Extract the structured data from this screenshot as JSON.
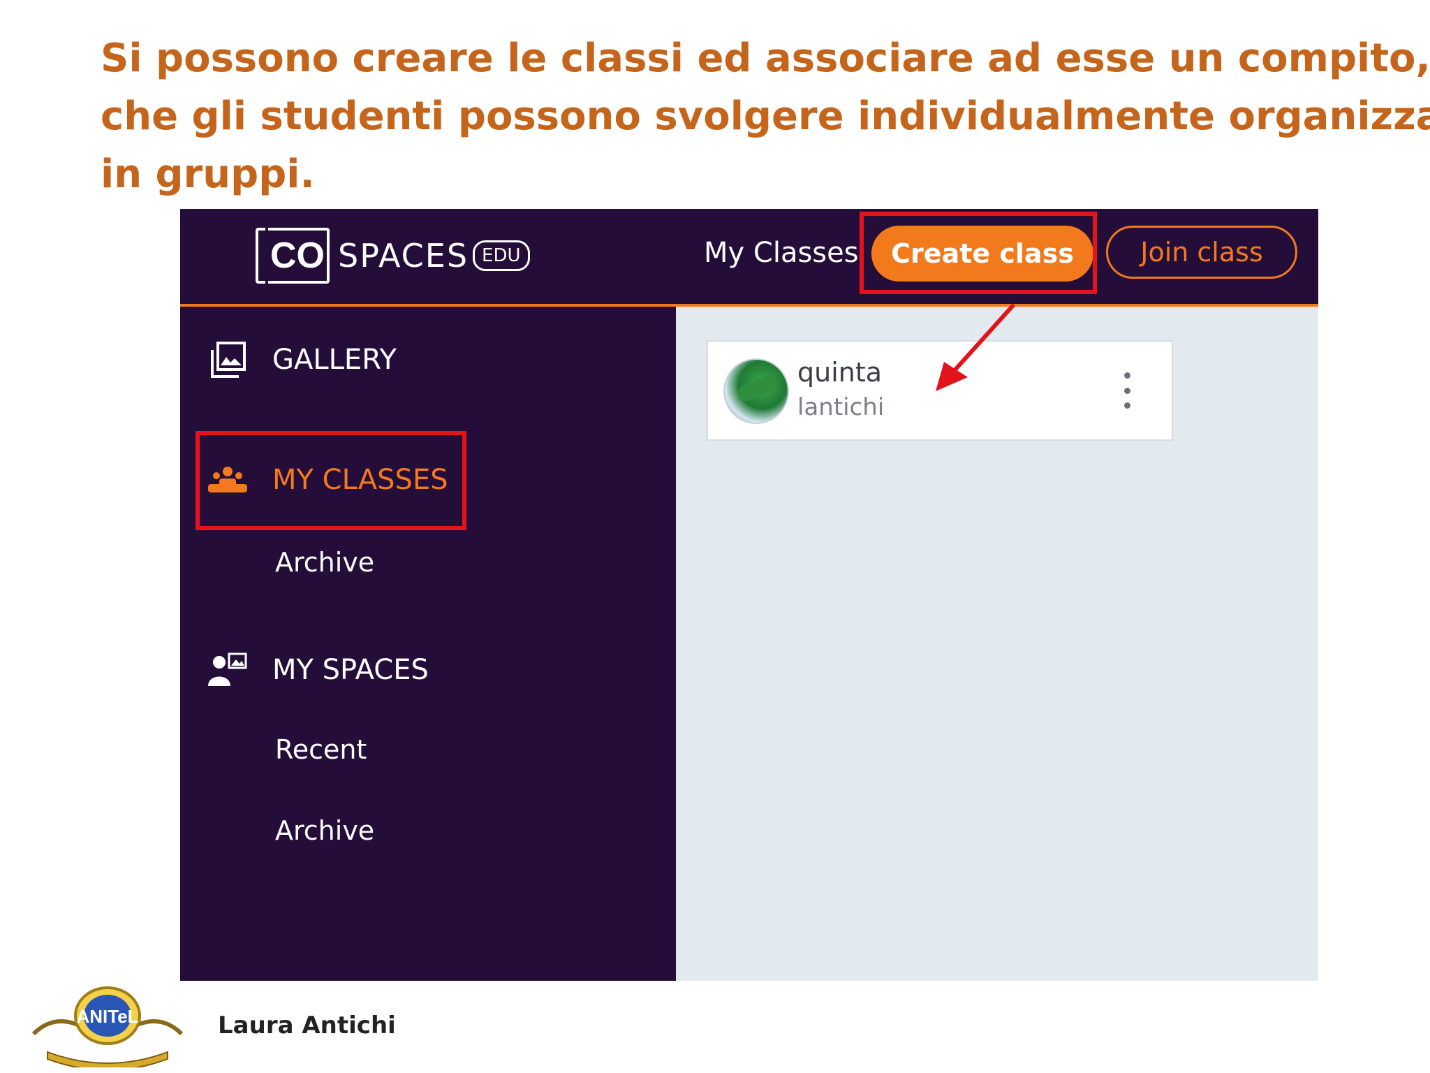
{
  "slide": {
    "title_lines": [
      "Si possono creare le classi ed associare ad esse un compito,",
      "che gli studenti possono svolgere individualmente organizzati",
      "in gruppi."
    ],
    "author": "Laura Antichi",
    "logo_text": "ANITeL"
  },
  "app": {
    "logo": {
      "co": "CO",
      "spaces": "SPACES",
      "edu": "EDU"
    },
    "topbar": {
      "my_classes": "My Classes",
      "create_class": "Create class",
      "join_class": "Join class"
    },
    "sidebar": {
      "gallery": "GALLERY",
      "my_classes": "MY CLASSES",
      "classes_archive": "Archive",
      "my_spaces": "MY SPACES",
      "recent": "Recent",
      "spaces_archive": "Archive"
    },
    "class_card": {
      "name": "quinta",
      "owner": "lantichi"
    }
  },
  "colors": {
    "title": "#c5651b",
    "app_bg": "#240e39",
    "accent": "#f27a1c",
    "content_bg": "#e2e9ef",
    "highlight": "#e3131b"
  },
  "icons": {
    "gallery": "gallery-icon",
    "classes": "classes-icon",
    "spaces": "spaces-icon",
    "menu": "more-vertical-icon"
  }
}
